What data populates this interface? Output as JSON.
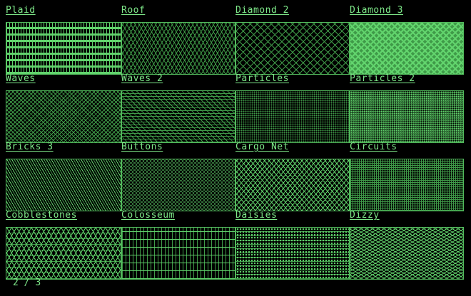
{
  "patterns": [
    {
      "name": "Plaid",
      "pattern": "plaid"
    },
    {
      "name": "Roof",
      "pattern": "roof"
    },
    {
      "name": "Diamond 2",
      "pattern": "diamond"
    },
    {
      "name": "Diamond 3",
      "pattern": "diamond-dense"
    },
    {
      "name": "Waves",
      "pattern": "waves"
    },
    {
      "name": "Waves 2",
      "pattern": "waves-fine"
    },
    {
      "name": "Particles",
      "pattern": "particles"
    },
    {
      "name": "Particles 2",
      "pattern": "particles-dense"
    },
    {
      "name": "Bricks 3",
      "pattern": "bricks"
    },
    {
      "name": "Buttons",
      "pattern": "buttons"
    },
    {
      "name": "Cargo Net",
      "pattern": "cargo-net"
    },
    {
      "name": "Circuits",
      "pattern": "circuits"
    },
    {
      "name": "Cobblestones",
      "pattern": "cobblestones"
    },
    {
      "name": "Colosseum",
      "pattern": "colosseum"
    },
    {
      "name": "Daisies",
      "pattern": "daisies"
    },
    {
      "name": "Dizzy",
      "pattern": "dizzy"
    }
  ],
  "pager": {
    "current": "2",
    "separator": "/",
    "total": "3"
  },
  "colors": {
    "background": "#000000",
    "foreground": "#6fe07a",
    "border": "#52b95c"
  }
}
